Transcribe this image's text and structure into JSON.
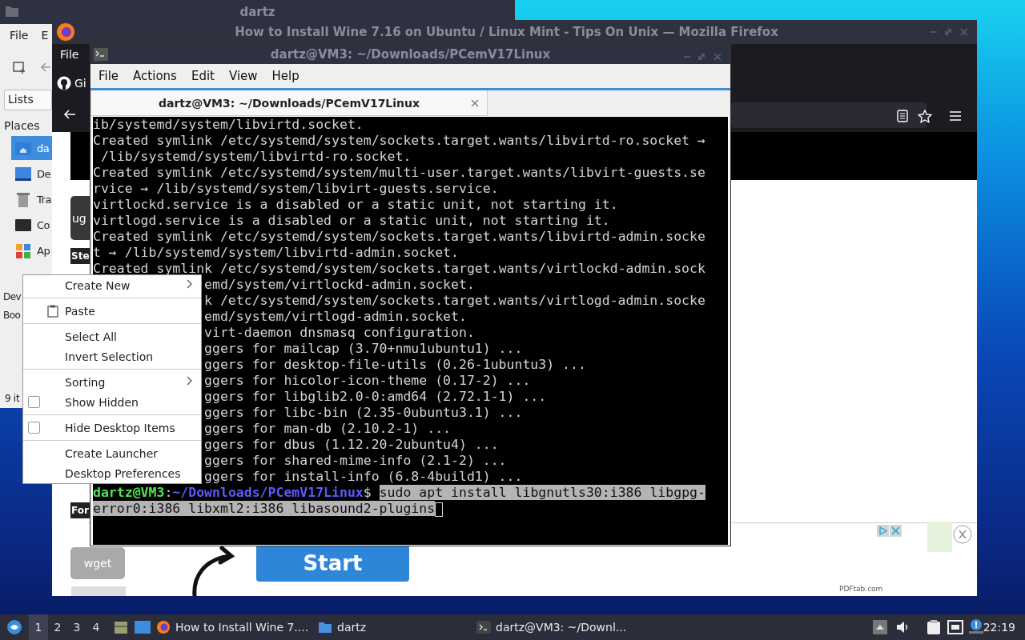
{
  "file_manager": {
    "title": "dartz",
    "menu": [
      "File",
      "E"
    ],
    "view_mode": "Lists",
    "places_heading": "Places",
    "places": [
      {
        "label": "da",
        "kind": "home",
        "selected": true
      },
      {
        "label": "De",
        "kind": "desktop",
        "selected": false
      },
      {
        "label": "Tra",
        "kind": "trash",
        "selected": false
      },
      {
        "label": "Co",
        "kind": "computer",
        "selected": false
      },
      {
        "label": "Ap",
        "kind": "apps",
        "selected": false
      }
    ],
    "devices_heading": "Dev",
    "bookmarks_heading": "Boo",
    "status": "9 it"
  },
  "firefox": {
    "title": "How to Install Wine 7.16 on Ubuntu / Linux Mint - Tips On Unix — Mozilla Firefox",
    "menu": [
      "File"
    ],
    "tab": "Gi",
    "page": {
      "side_items": [
        {
          "text": "ug",
          "kind": "dark-button"
        },
        {
          "text": "Ste",
          "kind": "dark-label"
        },
        {
          "text": "For",
          "kind": "dark-label"
        },
        {
          "text": "wget",
          "kind": "gray-button"
        }
      ],
      "start_button": "Start",
      "ad_credit": "PDFtab.com"
    }
  },
  "terminal": {
    "title": "dartz@VM3: ~/Downloads/PCemV17Linux",
    "menu": [
      "File",
      "Actions",
      "Edit",
      "View",
      "Help"
    ],
    "tab": "dartz@VM3: ~/Downloads/PCemV17Linux",
    "lines": [
      {
        "text": "ib/systemd/system/libvirtd.socket.",
        "kind": "full"
      },
      {
        "text": "Created symlink /etc/systemd/system/sockets.target.wants/libvirtd-ro.socket →",
        "kind": "full"
      },
      {
        "text": " /lib/systemd/system/libvirtd-ro.socket.",
        "kind": "full"
      },
      {
        "text": "Created symlink /etc/systemd/system/multi-user.target.wants/libvirt-guests.se",
        "kind": "full"
      },
      {
        "text": "rvice → /lib/systemd/system/libvirt-guests.service.",
        "kind": "full"
      },
      {
        "text": "virtlockd.service is a disabled or a static unit, not starting it.",
        "kind": "full"
      },
      {
        "text": "virtlogd.service is a disabled or a static unit, not starting it.",
        "kind": "full"
      },
      {
        "text": "Created symlink /etc/systemd/system/sockets.target.wants/libvirtd-admin.socke",
        "kind": "full"
      },
      {
        "text": "t → /lib/systemd/system/libvirtd-admin.socket.",
        "kind": "full"
      },
      {
        "text": "Created symlink /etc/systemd/system/sockets.target.wants/virtlockd-admin.sock",
        "kind": "full"
      },
      {
        "text": "emd/system/virtlockd-admin.socket.",
        "kind": "covered"
      },
      {
        "text": "k /etc/systemd/system/sockets.target.wants/virtlogd-admin.socke",
        "kind": "covered"
      },
      {
        "text": "emd/system/virtlogd-admin.socket.",
        "kind": "covered"
      },
      {
        "text": "virt-daemon dnsmasq configuration.",
        "kind": "covered"
      },
      {
        "text": "ggers for mailcap (3.70+nmu1ubuntu1) ...",
        "kind": "covered"
      },
      {
        "text": "ggers for desktop-file-utils (0.26-1ubuntu3) ...",
        "kind": "covered"
      },
      {
        "text": "ggers for hicolor-icon-theme (0.17-2) ...",
        "kind": "covered"
      },
      {
        "text": "ggers for libglib2.0-0:amd64 (2.72.1-1) ...",
        "kind": "covered"
      },
      {
        "text": "ggers for libc-bin (2.35-0ubuntu3.1) ...",
        "kind": "covered"
      },
      {
        "text": "ggers for man-db (2.10.2-1) ...",
        "kind": "covered"
      },
      {
        "text": "ggers for dbus (1.12.20-2ubuntu4) ...",
        "kind": "covered"
      },
      {
        "text": "ggers for shared-mime-info (2.1-2) ...",
        "kind": "covered"
      },
      {
        "text": "ggers for install-info (6.8-4build1) ...",
        "kind": "covered"
      }
    ],
    "prompt": {
      "user": "dartz@VM3",
      "separator": ":",
      "path": "~/Downloads/PCemV17Linux",
      "symbol": "$"
    },
    "command": {
      "selected": true,
      "lines": [
        "sudo apt install libgnutls30:i386 libgpg-",
        "error0:i386 libxml2:i386 libasound2-plugins"
      ]
    }
  },
  "context_menu": {
    "groups": [
      [
        {
          "label": "Create New",
          "kind": "submenu"
        }
      ],
      [
        {
          "label": "Paste",
          "kind": "paste"
        }
      ],
      [
        {
          "label": "Select All",
          "kind": "plain"
        },
        {
          "label": "Invert Selection",
          "kind": "plain"
        }
      ],
      [
        {
          "label": "Sorting",
          "kind": "submenu"
        },
        {
          "label": "Show Hidden",
          "kind": "check",
          "checked": false
        }
      ],
      [
        {
          "label": "Hide Desktop Items",
          "kind": "check",
          "checked": false
        }
      ],
      [
        {
          "label": "Create Launcher",
          "kind": "plain"
        },
        {
          "label": "Desktop Preferences",
          "kind": "plain"
        }
      ]
    ]
  },
  "taskbar": {
    "workspaces": [
      {
        "label": "1",
        "selected": true
      },
      {
        "label": "2",
        "selected": false
      },
      {
        "label": "3",
        "selected": false
      },
      {
        "label": "4",
        "selected": false
      }
    ],
    "tasks": [
      {
        "label": "How to Install Wine 7....",
        "kind": "browser"
      },
      {
        "label": "dartz",
        "kind": "folder"
      },
      {
        "label": "dartz@VM3: ~/Downl...",
        "kind": "terminal"
      }
    ],
    "clock": "22:19"
  }
}
